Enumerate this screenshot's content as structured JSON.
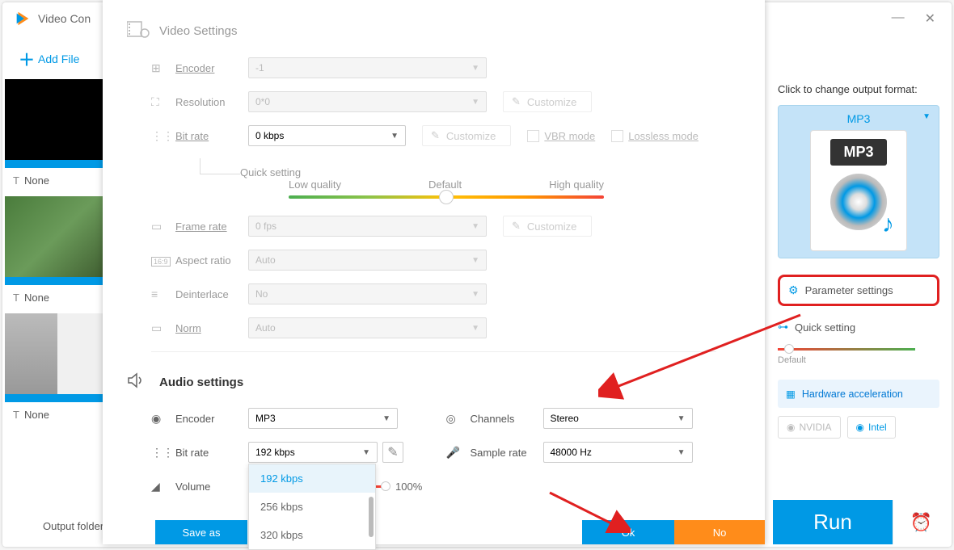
{
  "app": {
    "title": "Video Con"
  },
  "toolbar": {
    "add_file": "Add File"
  },
  "thumbs": {
    "label1": "None",
    "label2": "None",
    "label3": "None"
  },
  "dialog": {
    "video_section": "Video Settings",
    "audio_section": "Audio settings",
    "labels": {
      "encoder": "Encoder",
      "resolution": "Resolution",
      "bitrate": "Bit rate",
      "quick_setting": "Quick setting",
      "low": "Low quality",
      "default": "Default",
      "high": "High quality",
      "framerate": "Frame rate",
      "aspect": "Aspect ratio",
      "deinterlace": "Deinterlace",
      "norm": "Norm",
      "customize": "Customize",
      "vbr": "VBR mode",
      "lossless": "Lossless mode",
      "channels": "Channels",
      "samplerate": "Sample rate",
      "volume": "Volume"
    },
    "values": {
      "v_encoder": "-1",
      "v_resolution": "0*0",
      "v_bitrate": "0 kbps",
      "v_framerate": "0 fps",
      "v_aspect": "Auto",
      "v_deinterlace": "No",
      "v_norm": "Auto",
      "a_encoder": "MP3",
      "a_bitrate": "192 kbps",
      "a_channels": "Stereo",
      "a_samplerate": "48000 Hz",
      "volume_pct": "100%"
    },
    "bitrate_options": {
      "opt1": "192 kbps",
      "opt2": "256 kbps",
      "opt3": "320 kbps"
    },
    "buttons": {
      "save_as": "Save as",
      "ok": "Ok",
      "no": "No"
    }
  },
  "right": {
    "change_label": "Click to change output format:",
    "format": "MP3",
    "mp3_badge": "MP3",
    "param_settings": "Parameter settings",
    "quick_setting": "Quick setting",
    "default": "Default",
    "hw_accel": "Hardware acceleration",
    "nvidia": "NVIDIA",
    "intel": "Intel"
  },
  "bottom": {
    "output_folder": "Output folder:",
    "run": "Run"
  }
}
